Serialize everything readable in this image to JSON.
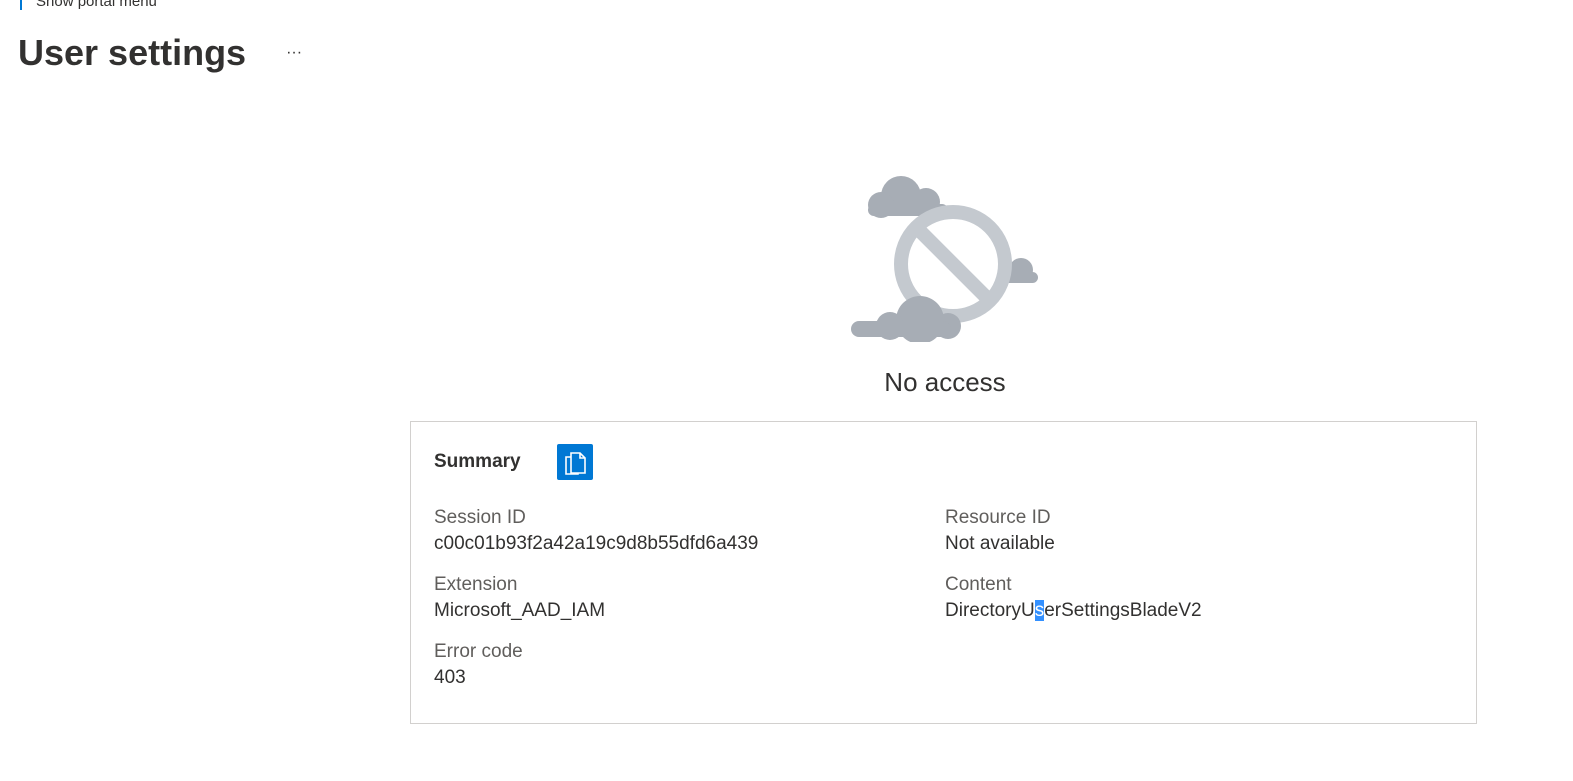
{
  "portal_menu": {
    "label": "Show portal menu"
  },
  "header": {
    "title": "User settings",
    "more_label": "···"
  },
  "icons": {
    "more": "ellipsis-icon",
    "copy": "copy-icon",
    "illustration": "no-access-illustration"
  },
  "colors": {
    "accent": "#0078d4",
    "illustration_gray": "#a7adb5"
  },
  "message": {
    "title": "No access"
  },
  "summary": {
    "title": "Summary",
    "fields": {
      "session_id": {
        "label": "Session ID",
        "value": "c00c01b93f2a42a19c9d8b55dfd6a439"
      },
      "resource_id": {
        "label": "Resource ID",
        "value": "Not available"
      },
      "extension": {
        "label": "Extension",
        "value": "Microsoft_AAD_IAM"
      },
      "content": {
        "label": "Content",
        "value_before": "DirectoryU",
        "value_selected": "s",
        "value_after": "erSettingsBladeV2"
      },
      "error_code": {
        "label": "Error code",
        "value": "403"
      }
    }
  }
}
